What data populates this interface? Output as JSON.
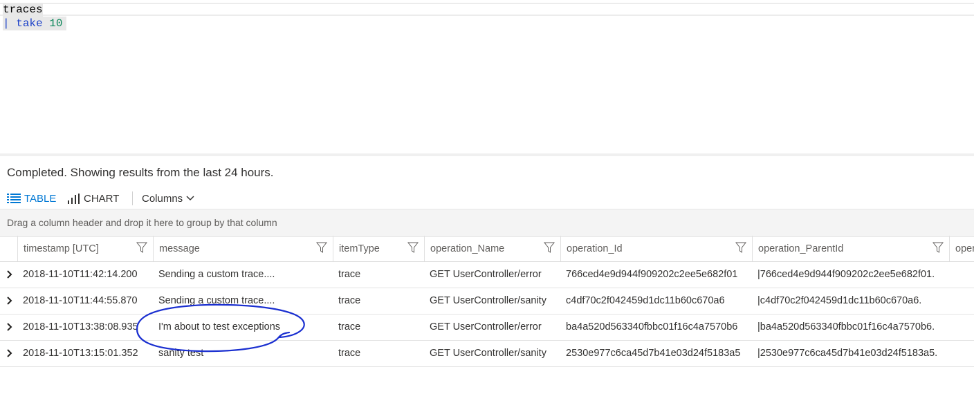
{
  "editor": {
    "line1": "traces",
    "line2_pipe": "|",
    "line2_keyword": "take",
    "line2_value": "10"
  },
  "splitter_grip": "...",
  "status": "Completed. Showing results from the last 24 hours.",
  "toolbar": {
    "table_label": "TABLE",
    "chart_label": "CHART",
    "columns_label": "Columns"
  },
  "groupbar_hint": "Drag a column header and drop it here to group by that column",
  "columns": [
    "timestamp [UTC]",
    "message",
    "itemType",
    "operation_Name",
    "operation_Id",
    "operation_ParentId",
    "oper"
  ],
  "rows": [
    {
      "timestamp": "2018-11-10T11:42:14.200",
      "message": "Sending a custom trace....",
      "itemType": "trace",
      "operation_Name": "GET UserController/error",
      "operation_Id": "766ced4e9d944f909202c2ee5e682f01",
      "operation_ParentId": "|766ced4e9d944f909202c2ee5e682f01."
    },
    {
      "timestamp": "2018-11-10T11:44:55.870",
      "message": "Sending a custom trace....",
      "itemType": "trace",
      "operation_Name": "GET UserController/sanity",
      "operation_Id": "c4df70c2f042459d1dc11b60c670a6",
      "operation_ParentId": "|c4df70c2f042459d1dc11b60c670a6."
    },
    {
      "timestamp": "2018-11-10T13:38:08.935",
      "message": "I'm about to test exceptions",
      "itemType": "trace",
      "operation_Name": "GET UserController/error",
      "operation_Id": "ba4a520d563340fbbc01f16c4a7570b6",
      "operation_ParentId": "|ba4a520d563340fbbc01f16c4a7570b6."
    },
    {
      "timestamp": "2018-11-10T13:15:01.352",
      "message": "sanity test",
      "itemType": "trace",
      "operation_Name": "GET UserController/sanity",
      "operation_Id": "2530e977c6ca45d7b41e03d24f5183a5",
      "operation_ParentId": "|2530e977c6ca45d7b41e03d24f5183a5."
    }
  ],
  "colors": {
    "accent": "#0078d4",
    "annotation": "#1a2fd0"
  }
}
